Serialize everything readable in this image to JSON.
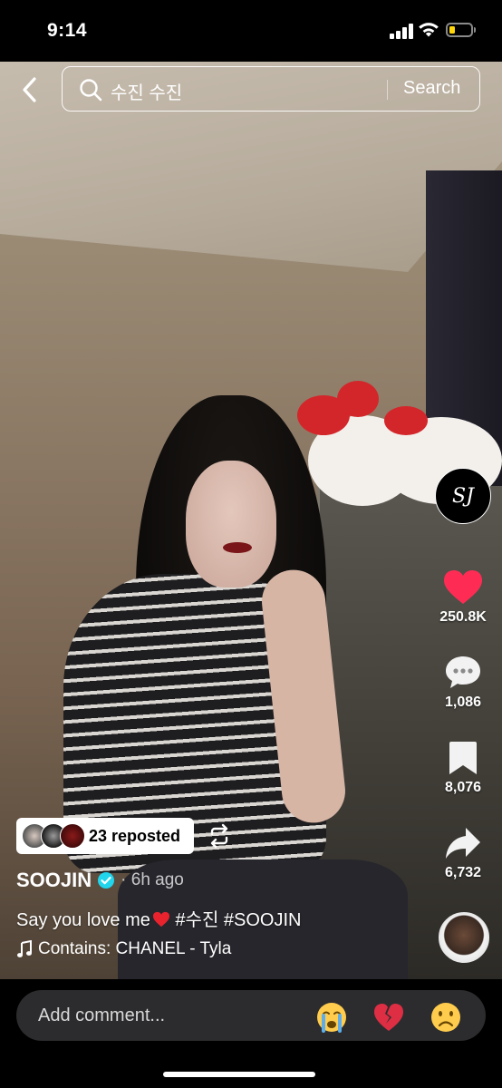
{
  "status_bar": {
    "time": "9:14",
    "battery_color": "#ffd60a"
  },
  "search": {
    "query": "수진 수진",
    "button_label": "Search"
  },
  "rail": {
    "creator_avatar_text": "SJ",
    "likes": "250.8K",
    "comments": "1,086",
    "saves": "8,076",
    "shares": "6,732",
    "like_color": "#fe2c55"
  },
  "post": {
    "repost_label": "23 reposted",
    "author": "SOOJIN",
    "time_ago": "6h ago",
    "caption_text": "Say you love me",
    "caption_tags": " #수진 #SOOJIN",
    "music": "Contains: CHANEL - Tyla",
    "verified_color": "#20d5ec"
  },
  "comment_bar": {
    "placeholder": "Add comment...",
    "emojis": [
      "crying-face",
      "broken-heart",
      "frowning-face"
    ]
  }
}
